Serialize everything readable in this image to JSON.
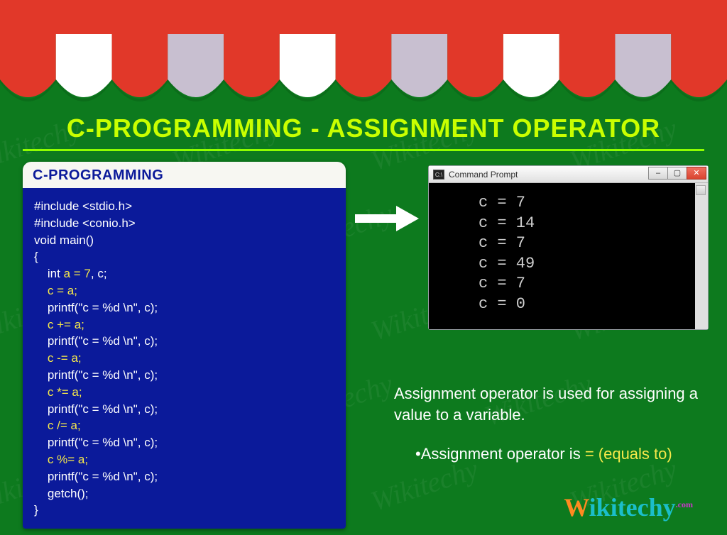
{
  "title": "C-PROGRAMMING - ASSIGNMENT OPERATOR",
  "code": {
    "header": "C-PROGRAMMING",
    "lines": [
      [
        {
          "t": "#include <stdio.h>",
          "y": false
        }
      ],
      [
        {
          "t": "#include <conio.h>",
          "y": false
        }
      ],
      [
        {
          "t": "void main()",
          "y": false
        }
      ],
      [
        {
          "t": "{",
          "y": false
        }
      ],
      [
        {
          "t": "    int ",
          "y": false
        },
        {
          "t": "a = 7",
          "y": true
        },
        {
          "t": ", c;",
          "y": false
        }
      ],
      [
        {
          "t": "    ",
          "y": false
        },
        {
          "t": "c = a;",
          "y": true
        }
      ],
      [
        {
          "t": "    printf(\"c = %d \\n\", c);",
          "y": false
        }
      ],
      [
        {
          "t": "    ",
          "y": false
        },
        {
          "t": "c += a;",
          "y": true
        }
      ],
      [
        {
          "t": "    printf(\"c = %d \\n\", c);",
          "y": false
        }
      ],
      [
        {
          "t": "    ",
          "y": false
        },
        {
          "t": "c -= a;",
          "y": true
        }
      ],
      [
        {
          "t": "    printf(\"c = %d \\n\", c);",
          "y": false
        }
      ],
      [
        {
          "t": "    ",
          "y": false
        },
        {
          "t": "c *= a;",
          "y": true
        }
      ],
      [
        {
          "t": "    printf(\"c = %d \\n\", c);",
          "y": false
        }
      ],
      [
        {
          "t": "    ",
          "y": false
        },
        {
          "t": "c /= a;",
          "y": true
        }
      ],
      [
        {
          "t": "    printf(\"c = %d \\n\", c);",
          "y": false
        }
      ],
      [
        {
          "t": "    ",
          "y": false
        },
        {
          "t": "c %= a;",
          "y": true
        }
      ],
      [
        {
          "t": "    printf(\"c = %d \\n\", c);",
          "y": false
        }
      ],
      [
        {
          "t": "    getch();",
          "y": false
        }
      ],
      [
        {
          "t": "}",
          "y": false
        }
      ]
    ]
  },
  "console": {
    "title": "Command Prompt",
    "icon_text": "C:\\",
    "output_lines": [
      "c = 7",
      "c = 14",
      "c = 7",
      "c = 49",
      "c = 7",
      "c = 0"
    ]
  },
  "description": {
    "line1": "Assignment operator is used for assigning a value to a variable.",
    "bullet_prefix": "•Assignment operator is ",
    "bullet_highlight": "= (equals to)"
  },
  "brand": {
    "w": "W",
    "rest": "ikitechy",
    "dot": ".com"
  },
  "awning": {
    "red": "#e13829",
    "white": "#ffffff",
    "grey": "#c8bfd0",
    "shadow": "#0a5f16"
  },
  "watermark_text": "Wikitechy"
}
